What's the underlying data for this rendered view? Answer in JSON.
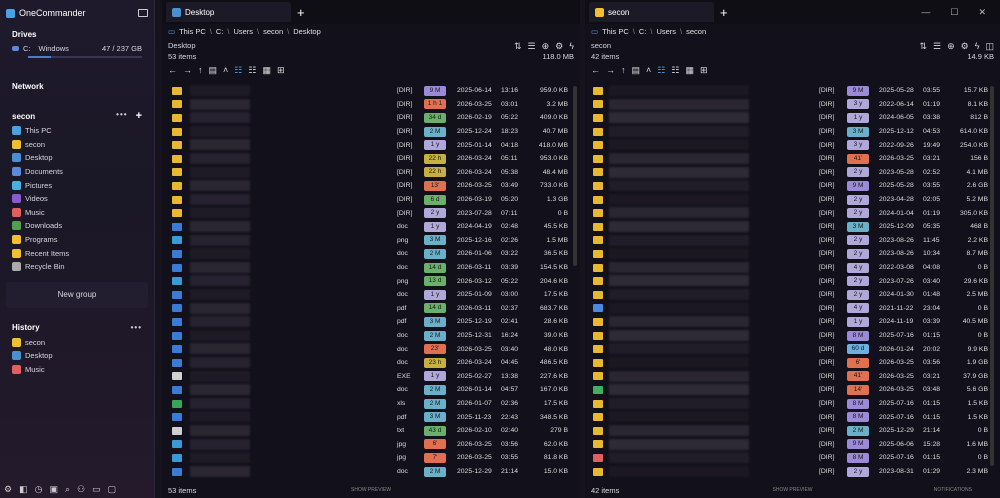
{
  "app": {
    "title": "OneCommander"
  },
  "sidebar": {
    "drives_title": "Drives",
    "drive": {
      "letter": "C:",
      "name": "Windows",
      "usage": "47 / 237 GB",
      "used_fraction": 0.2
    },
    "network_title": "Network",
    "group_title": "secon",
    "items": [
      {
        "label": "This PC",
        "color": "#4aa3e0"
      },
      {
        "label": "secon",
        "color": "#f0c030"
      },
      {
        "label": "Desktop",
        "color": "#4a90d0"
      },
      {
        "label": "Documents",
        "color": "#5a8ad8"
      },
      {
        "label": "Pictures",
        "color": "#4ab0e0"
      },
      {
        "label": "Videos",
        "color": "#8a5ad0"
      },
      {
        "label": "Music",
        "color": "#e06060"
      },
      {
        "label": "Downloads",
        "color": "#50a050"
      },
      {
        "label": "Programs",
        "color": "#f0c030"
      },
      {
        "label": "Recent Items",
        "color": "#f0c030"
      },
      {
        "label": "Recycle Bin",
        "color": "#aaaaaa"
      }
    ],
    "new_group": "New group",
    "history_title": "History",
    "history": [
      {
        "label": "secon",
        "color": "#f0c030"
      },
      {
        "label": "Desktop",
        "color": "#4a90d0"
      },
      {
        "label": "Music",
        "color": "#e06060"
      }
    ]
  },
  "left": {
    "tab": "Desktop",
    "path": [
      "This PC",
      "C:",
      "Users",
      "secon",
      "Desktop"
    ],
    "folder": "Desktop",
    "items": "53 items",
    "size": "118.0 MB",
    "footer": "53 items",
    "rows": [
      [
        "[DIR]",
        "9 M",
        "#9a8ad8",
        "2025-06-14",
        "13:16",
        "959.0 KB",
        "folder"
      ],
      [
        "[DIR]",
        "1 h 1",
        "#e07050",
        "2026-03-25",
        "03:01",
        "3.2 MB",
        "folder"
      ],
      [
        "[DIR]",
        "34 d",
        "#6ab06a",
        "2026-02-19",
        "05:22",
        "409.0 KB",
        "folder"
      ],
      [
        "[DIR]",
        "2 M",
        "#6ab0c8",
        "2025-12-24",
        "18:23",
        "40.7 MB",
        "folder"
      ],
      [
        "[DIR]",
        "1 y",
        "#b0a8d8",
        "2025-01-14",
        "04:18",
        "418.0 MB",
        "folder"
      ],
      [
        "[DIR]",
        "22 h",
        "#c8b040",
        "2026-03-24",
        "05:11",
        "953.0 KB",
        "folder"
      ],
      [
        "[DIR]",
        "22 h",
        "#c8b040",
        "2026-03-24",
        "05:38",
        "48.4 MB",
        "folder"
      ],
      [
        "[DIR]",
        "13'",
        "#e07050",
        "2026-03-25",
        "03:49",
        "733.0 KB",
        "folder"
      ],
      [
        "[DIR]",
        "6 d",
        "#6ab06a",
        "2026-03-19",
        "05:20",
        "1.3 GB",
        "folder"
      ],
      [
        "[DIR]",
        "2 y",
        "#b0a8d8",
        "2023-07-28",
        "07:11",
        "0 B",
        "folder"
      ],
      [
        "doc",
        "1 y",
        "#b0a8d8",
        "2024-04-19",
        "02:48",
        "45.5 KB",
        "doc"
      ],
      [
        "png",
        "3 M",
        "#6ab0c8",
        "2025-12-16",
        "02:26",
        "1.5 MB",
        "img"
      ],
      [
        "doc",
        "2 M",
        "#6ab0c8",
        "2026-01-06",
        "03:22",
        "36.5 KB",
        "doc"
      ],
      [
        "doc",
        "14 d",
        "#6ab06a",
        "2026-03-11",
        "03:39",
        "154.5 KB",
        "doc"
      ],
      [
        "png",
        "13 d",
        "#6ab06a",
        "2026-03-12",
        "05:22",
        "204.6 KB",
        "img"
      ],
      [
        "doc",
        "1 y",
        "#b0a8d8",
        "2025-01-09",
        "03:00",
        "17.5 KB",
        "doc"
      ],
      [
        "pdf",
        "14 d",
        "#6ab06a",
        "2026-03-11",
        "02:37",
        "683.7 KB",
        "pdf"
      ],
      [
        "pdf",
        "3 M",
        "#6ab0c8",
        "2025-12-19",
        "02:41",
        "28.6 KB",
        "pdf"
      ],
      [
        "doc",
        "2 M",
        "#6ab0c8",
        "2025-12-31",
        "16:24",
        "39.0 KB",
        "doc"
      ],
      [
        "doc",
        "23'",
        "#e07050",
        "2026-03-25",
        "03:40",
        "48.0 KB",
        "doc"
      ],
      [
        "doc",
        "23 h",
        "#c8b040",
        "2026-03-24",
        "04:45",
        "486.5 KB",
        "doc"
      ],
      [
        "EXE",
        "1 y",
        "#b0a8d8",
        "2025-02-27",
        "13:38",
        "227.6 KB",
        "exe"
      ],
      [
        "doc",
        "2 M",
        "#6ab0c8",
        "2026-01-14",
        "04:57",
        "167.0 KB",
        "doc"
      ],
      [
        "xls",
        "2 M",
        "#6ab0c8",
        "2026-01-07",
        "02:36",
        "17.5 KB",
        "xls"
      ],
      [
        "pdf",
        "3 M",
        "#6ab0c8",
        "2025-11-23",
        "22:43",
        "348.5 KB",
        "pdf"
      ],
      [
        "txt",
        "43 d",
        "#6ab06a",
        "2026-02-10",
        "02:40",
        "279 B",
        "txt"
      ],
      [
        "jpg",
        "6'",
        "#e07050",
        "2026-03-25",
        "03:56",
        "62.0 KB",
        "img"
      ],
      [
        "jpg",
        "7'",
        "#e07050",
        "2026-03-25",
        "03:55",
        "81.8 KB",
        "img"
      ],
      [
        "doc",
        "2 M",
        "#6ab0c8",
        "2025-12-29",
        "21:14",
        "15.0 KB",
        "doc"
      ]
    ]
  },
  "right": {
    "tab": "secon",
    "path": [
      "This PC",
      "C:",
      "Users",
      "secon"
    ],
    "folder": "secon",
    "items": "42 items",
    "size": "14.9 KB",
    "footer": "42 items",
    "rows": [
      [
        "[DIR]",
        "9 M",
        "#9a8ad8",
        "2025-05-28",
        "03:55",
        "15.7 KB",
        "folder"
      ],
      [
        "[DIR]",
        "3 y",
        "#b0a8d8",
        "2022-06-14",
        "01:19",
        "8.1 KB",
        "folder"
      ],
      [
        "[DIR]",
        "1 y",
        "#b0a8d8",
        "2024-06-05",
        "03:38",
        "812 B",
        "folder"
      ],
      [
        "[DIR]",
        "3 M",
        "#6ab0c8",
        "2025-12-12",
        "04:53",
        "614.0 KB",
        "folder"
      ],
      [
        "[DIR]",
        "3 y",
        "#b0a8d8",
        "2022-09-26",
        "19:49",
        "254.0 KB",
        "folder"
      ],
      [
        "[DIR]",
        "41'",
        "#e07050",
        "2026-03-25",
        "03:21",
        "156 B",
        "folder"
      ],
      [
        "[DIR]",
        "2 y",
        "#b0a8d8",
        "2023-05-28",
        "02:52",
        "4.1 MB",
        "folder"
      ],
      [
        "[DIR]",
        "9 M",
        "#9a8ad8",
        "2025-05-28",
        "03:55",
        "2.6 GB",
        "folder"
      ],
      [
        "[DIR]",
        "2 y",
        "#b0a8d8",
        "2023-04-28",
        "02:05",
        "5.2 MB",
        "folder"
      ],
      [
        "[DIR]",
        "2 y",
        "#b0a8d8",
        "2024-01-04",
        "01:19",
        "305.0 KB",
        "folder"
      ],
      [
        "[DIR]",
        "3 M",
        "#6ab0c8",
        "2025-12-09",
        "05:35",
        "468 B",
        "folder"
      ],
      [
        "[DIR]",
        "2 y",
        "#b0a8d8",
        "2023-08-26",
        "11:45",
        "2.2 KB",
        "folder"
      ],
      [
        "[DIR]",
        "2 y",
        "#b0a8d8",
        "2023-08-26",
        "10:34",
        "8.7 MB",
        "folder"
      ],
      [
        "[DIR]",
        "4 y",
        "#b0a8d8",
        "2022-03-08",
        "04:08",
        "0 B",
        "folder"
      ],
      [
        "[DIR]",
        "2 y",
        "#b0a8d8",
        "2023-07-26",
        "03:40",
        "29.6 KB",
        "folder"
      ],
      [
        "[DIR]",
        "2 y",
        "#b0a8d8",
        "2024-01-30",
        "01:48",
        "2.5 MB",
        "folder"
      ],
      [
        "[DIR]",
        "4 y",
        "#b0a8d8",
        "2021-11-22",
        "23:04",
        "0 B",
        "cube"
      ],
      [
        "[DIR]",
        "1 y",
        "#b0a8d8",
        "2024-11-19",
        "03:39",
        "40.5 MB",
        "folder"
      ],
      [
        "[DIR]",
        "8 M",
        "#9a8ad8",
        "2025-07-16",
        "01:15",
        "0 B",
        "folder"
      ],
      [
        "[DIR]",
        "60 d",
        "#6ab0e0",
        "2026-01-24",
        "20:02",
        "9.9 KB",
        "folder"
      ],
      [
        "[DIR]",
        "6'",
        "#e07050",
        "2026-03-25",
        "03:56",
        "1.9 GB",
        "folder"
      ],
      [
        "[DIR]",
        "41'",
        "#e07050",
        "2026-03-25",
        "03:21",
        "37.9 GB",
        "folder"
      ],
      [
        "[DIR]",
        "14'",
        "#e07050",
        "2026-03-25",
        "03:48",
        "5.6 GB",
        "dl"
      ],
      [
        "[DIR]",
        "8 M",
        "#9a8ad8",
        "2025-07-16",
        "01:15",
        "1.5 KB",
        "folder"
      ],
      [
        "[DIR]",
        "8 M",
        "#9a8ad8",
        "2025-07-16",
        "01:15",
        "1.5 KB",
        "folder"
      ],
      [
        "[DIR]",
        "2 M",
        "#6ab0c8",
        "2025-12-29",
        "21:14",
        "0 B",
        "folder"
      ],
      [
        "[DIR]",
        "9 M",
        "#9a8ad8",
        "2025-06-06",
        "15:28",
        "1.6 MB",
        "folder"
      ],
      [
        "[DIR]",
        "8 M",
        "#9a8ad8",
        "2025-07-16",
        "01:15",
        "0 B",
        "music"
      ],
      [
        "[DIR]",
        "2 y",
        "#b0a8d8",
        "2023-08-31",
        "01:29",
        "2.3 MB",
        "folder"
      ]
    ]
  },
  "labels": {
    "show_preview": "SHOW PREVIEW",
    "notifications": "NOTIFICATIONS"
  }
}
